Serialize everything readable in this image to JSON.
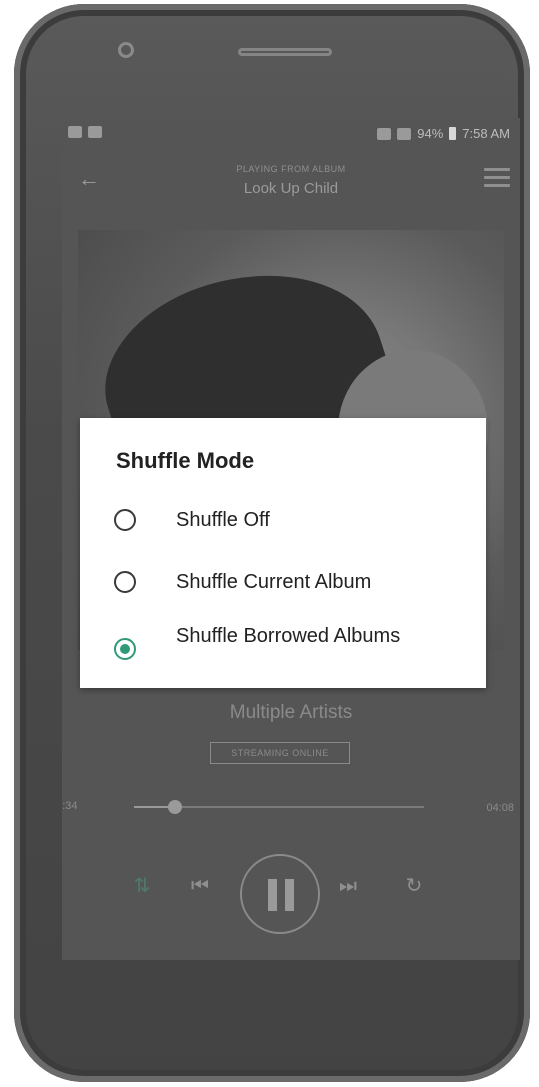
{
  "status_bar": {
    "battery": "94%",
    "time": "7:58 AM"
  },
  "now_playing": {
    "context_label": "PLAYING FROM ALBUM",
    "album_title": "Look Up Child",
    "artist": "Multiple Artists",
    "streaming_badge": "STREAMING ONLINE",
    "elapsed": "00:34",
    "duration": "04:08",
    "progress_fraction": 0.14
  },
  "dialog": {
    "title": "Shuffle Mode",
    "options": [
      {
        "label": "Shuffle Off",
        "selected": false
      },
      {
        "label": "Shuffle Current Album",
        "selected": false
      },
      {
        "label": "Shuffle Borrowed Albums",
        "selected": true
      }
    ]
  },
  "icons": {
    "back": "arrow-left-icon",
    "menu": "hamburger-menu-icon",
    "shuffle": "shuffle-icon",
    "previous": "skip-previous-icon",
    "pause": "pause-icon",
    "next": "skip-next-icon",
    "repeat": "repeat-icon"
  },
  "colors": {
    "accent": "#2f9a7a",
    "dimmed_screen": "#555555"
  }
}
